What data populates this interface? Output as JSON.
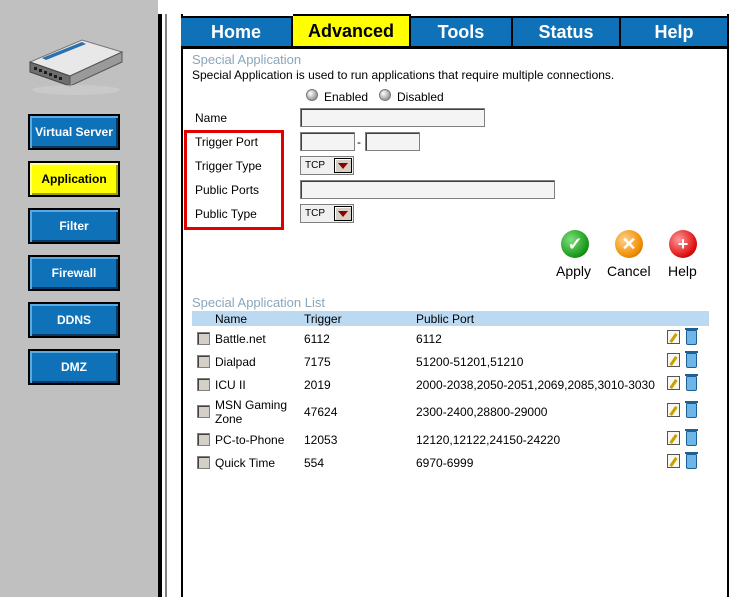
{
  "tabs": [
    {
      "label": "Home",
      "active": false
    },
    {
      "label": "Advanced",
      "active": true
    },
    {
      "label": "Tools",
      "active": false
    },
    {
      "label": "Status",
      "active": false
    },
    {
      "label": "Help",
      "active": false
    }
  ],
  "sidebar": {
    "items": [
      {
        "label": "Virtual Server",
        "active": false
      },
      {
        "label": "Application",
        "active": true
      },
      {
        "label": "Filter",
        "active": false
      },
      {
        "label": "Firewall",
        "active": false
      },
      {
        "label": "DDNS",
        "active": false
      },
      {
        "label": "DMZ",
        "active": false
      }
    ]
  },
  "section": {
    "title": "Special Application",
    "description": "Special Application is used to run applications that require multiple connections.",
    "enabled_label": "Enabled",
    "disabled_label": "Disabled",
    "name_label": "Name",
    "trigger_port_label": "Trigger Port",
    "trigger_port_sep": "-",
    "trigger_type_label": "Trigger Type",
    "trigger_type_value": "TCP",
    "public_ports_label": "Public Ports",
    "public_type_label": "Public Type",
    "public_type_value": "TCP"
  },
  "actions": {
    "apply": "Apply",
    "cancel": "Cancel",
    "help": "Help"
  },
  "list": {
    "title": "Special Application List",
    "headers": {
      "name": "Name",
      "trigger": "Trigger",
      "public_port": "Public Port"
    },
    "rows": [
      {
        "name": "Battle.net",
        "trigger": "6112",
        "public_port": "6112"
      },
      {
        "name": "Dialpad",
        "trigger": "7175",
        "public_port": "51200-51201,51210"
      },
      {
        "name": "ICU II",
        "trigger": "2019",
        "public_port": "2000-2038,2050-2051,2069,2085,3010-3030"
      },
      {
        "name": "MSN Gaming Zone",
        "trigger": "47624",
        "public_port": "2300-2400,28800-29000"
      },
      {
        "name": "PC-to-Phone",
        "trigger": "12053",
        "public_port": "12120,12122,24150-24220"
      },
      {
        "name": "Quick Time",
        "trigger": "554",
        "public_port": "6970-6999"
      }
    ]
  },
  "colors": {
    "tab_blue": "#0f71b8",
    "active_yellow": "#ffff00",
    "highlight_red": "#e00000",
    "title_gray_blue": "#8aa6bb"
  }
}
